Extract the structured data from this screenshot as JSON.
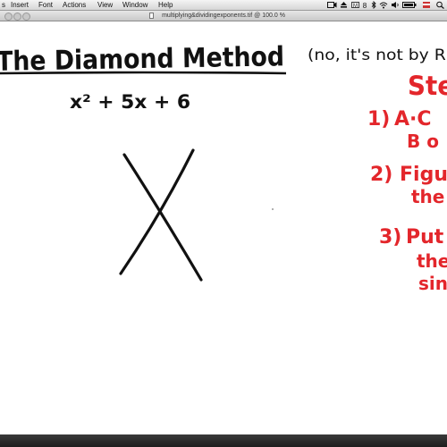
{
  "menubar": {
    "items": [
      "Insert",
      "Font",
      "Actions",
      "View",
      "Window",
      "Help"
    ]
  },
  "window": {
    "title": "multiplying&dividingexponents.tif @ 100.0 %"
  },
  "note": {
    "heading": "The Diamond Method",
    "aside": "(no, it's not by Ri",
    "expression": "x² + 5x + 6",
    "steps_heading": "Ste",
    "steps": [
      {
        "number": "1)",
        "line1": "A·C",
        "line2": "B o"
      },
      {
        "number": "2)",
        "line1": "Figu",
        "line2": "the"
      },
      {
        "number": "3)",
        "line1": "Put",
        "line2": "the",
        "line3": "sin"
      }
    ]
  },
  "colors": {
    "ink": "#111111",
    "red_ink": "#e3262b",
    "paper": "#ffffff"
  }
}
